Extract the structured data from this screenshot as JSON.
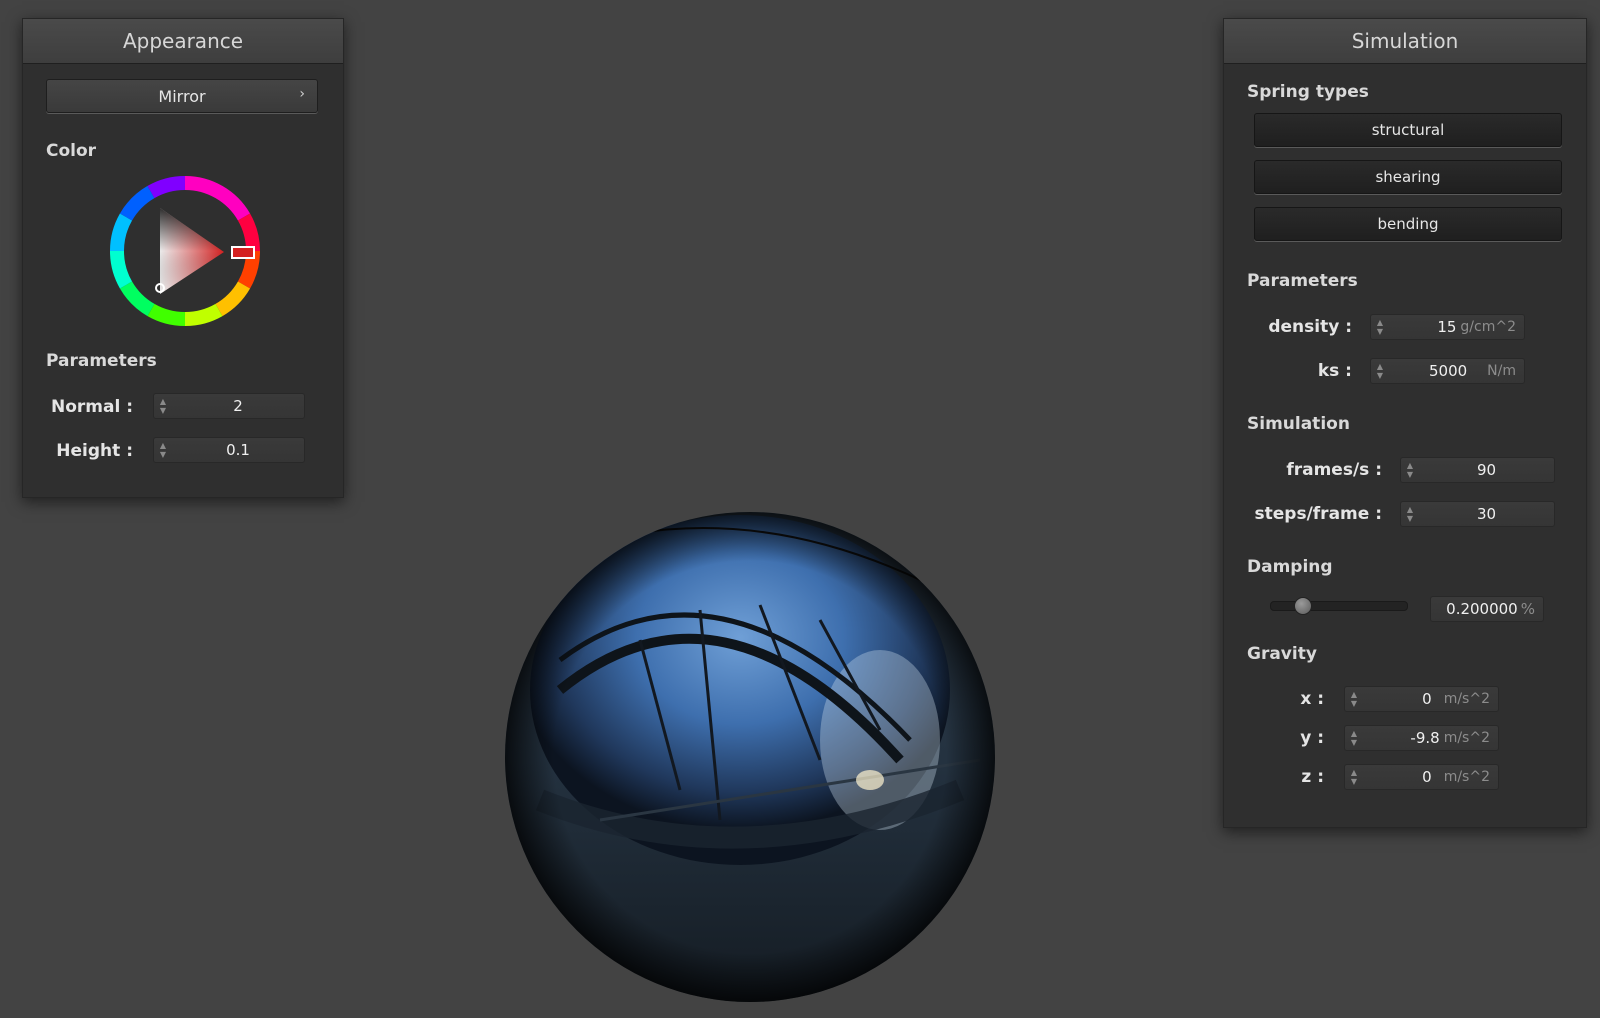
{
  "appearance": {
    "title": "Appearance",
    "shader_label": "Mirror",
    "color_label": "Color",
    "selected_color": "#cc2a2a",
    "parameters_label": "Parameters",
    "normal": {
      "label": "Normal :",
      "value": "2"
    },
    "height": {
      "label": "Height :",
      "value": "0.1"
    }
  },
  "simulation": {
    "title": "Simulation",
    "spring_types_label": "Spring types",
    "spring_types": [
      "structural",
      "shearing",
      "bending"
    ],
    "parameters_label": "Parameters",
    "density": {
      "label": "density :",
      "value": "15",
      "unit": "g/cm^2"
    },
    "ks": {
      "label": "ks :",
      "value": "5000",
      "unit": "N/m"
    },
    "simulation_label": "Simulation",
    "frames_per_s": {
      "label": "frames/s :",
      "value": "90"
    },
    "steps_per_frame": {
      "label": "steps/frame :",
      "value": "30"
    },
    "damping_label": "Damping",
    "damping": {
      "value": "0.200000",
      "unit": "%",
      "slider_fraction": 0.2
    },
    "gravity_label": "Gravity",
    "gravity": {
      "x": {
        "label": "x :",
        "value": "0",
        "unit": "m/s^2"
      },
      "y": {
        "label": "y :",
        "value": "-9.8",
        "unit": "m/s^2"
      },
      "z": {
        "label": "z :",
        "value": "0",
        "unit": "m/s^2"
      }
    }
  },
  "icons": {
    "spin_up": "▲",
    "spin_down": "▼",
    "chevron_right": "›"
  }
}
